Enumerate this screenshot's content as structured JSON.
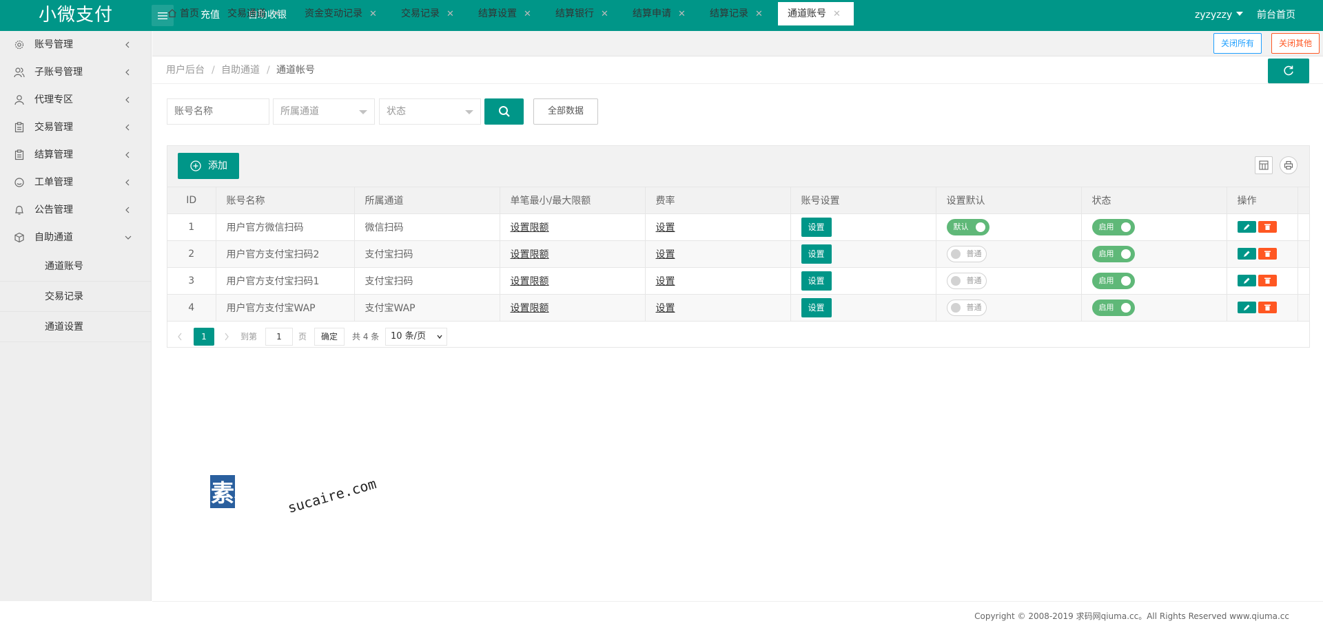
{
  "header": {
    "logo": "小微支付",
    "nav": [
      "充值",
      "自助收银"
    ],
    "user": "zyzyzzy",
    "home_link": "前台首页"
  },
  "sidebar": {
    "items": [
      {
        "label": "账号管理",
        "icon": "gear-icon"
      },
      {
        "label": "子账号管理",
        "icon": "users-icon"
      },
      {
        "label": "代理专区",
        "icon": "user-icon"
      },
      {
        "label": "交易管理",
        "icon": "clipboard-icon"
      },
      {
        "label": "结算管理",
        "icon": "clipboard-icon"
      },
      {
        "label": "工单管理",
        "icon": "smile-icon"
      },
      {
        "label": "公告管理",
        "icon": "bell-icon"
      },
      {
        "label": "自助通道",
        "icon": "cube-icon"
      }
    ],
    "sub_items": [
      "通道账号",
      "交易记录",
      "通道设置"
    ]
  },
  "tabs": {
    "items": [
      "首页",
      "交易通道",
      "资金变动记录",
      "交易记录",
      "结算设置",
      "结算银行",
      "结算申请",
      "结算记录",
      "通道账号"
    ],
    "close_all": "关闭所有",
    "close_other": "关闭其他"
  },
  "breadcrumb": [
    "用户后台",
    "自助通道",
    "通道帐号"
  ],
  "search": {
    "name_placeholder": "账号名称",
    "channel_placeholder": "所属通道",
    "status_placeholder": "状态",
    "all_label": "全部数据"
  },
  "toolbar": {
    "add_label": "添加"
  },
  "table": {
    "columns": [
      "ID",
      "账号名称",
      "所属通道",
      "单笔最小/最大限额",
      "费率",
      "账号设置",
      "设置默认",
      "状态",
      "操作"
    ],
    "rows": [
      {
        "id": "1",
        "name": "用户官方微信扫码",
        "channel": "微信扫码",
        "limit": "设置限额",
        "rate": "设置",
        "setting": "设置",
        "default": "默认",
        "default_on": true,
        "status": "启用"
      },
      {
        "id": "2",
        "name": "用户官方支付宝扫码2",
        "channel": "支付宝扫码",
        "limit": "设置限额",
        "rate": "设置",
        "setting": "设置",
        "default": "普通",
        "default_on": false,
        "status": "启用"
      },
      {
        "id": "3",
        "name": "用户官方支付宝扫码1",
        "channel": "支付宝扫码",
        "limit": "设置限额",
        "rate": "设置",
        "setting": "设置",
        "default": "普通",
        "default_on": false,
        "status": "启用"
      },
      {
        "id": "4",
        "name": "用户官方支付宝WAP",
        "channel": "支付宝WAP",
        "limit": "设置限额",
        "rate": "设置",
        "setting": "设置",
        "default": "普通",
        "default_on": false,
        "status": "启用"
      }
    ]
  },
  "pager": {
    "current": "1",
    "goto_label": "到第",
    "page_input": "1",
    "page_unit": "页",
    "ok_label": "确定",
    "total": "共 4 条",
    "size": "10 条/页"
  },
  "footer": {
    "copyright": "Copyright © 2008-2019 求码网qiuma.cc。All Rights Reserved www.qiuma.cc"
  },
  "watermark": {
    "cn": "素材熟",
    "en": "sucaire.com"
  },
  "colors": {
    "primary": "#009688",
    "switch_on": "#5FB878",
    "danger": "#FF5722",
    "info": "#1E9FFF"
  }
}
